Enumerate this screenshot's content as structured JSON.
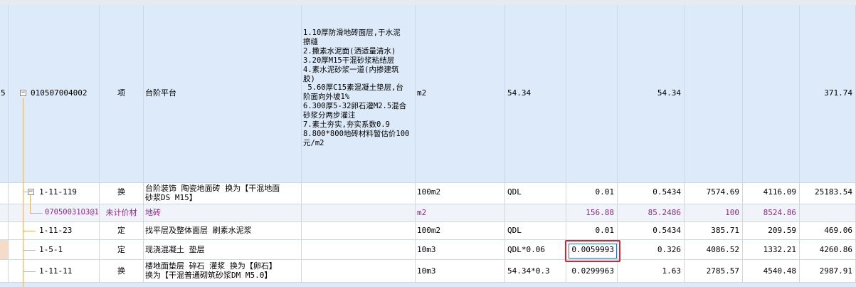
{
  "rows": [
    {
      "row_no": "5",
      "code": "010507004002",
      "category": "项",
      "name": "台阶平台",
      "desc_lines": [
        "1.10厚防滑地砖面层,于水泥",
        "擦缝",
        "2.撒素水泥面(洒适量清水)",
        "3.20厚M15干混砂浆粘结层",
        "4.素水泥砂浆一道(内掺建筑",
        "胶)",
        " 5.60厚C15素混凝土垫层,台",
        "阶面向外坡1%",
        "6.300厚5-32卵石灌M2.5混合",
        "砂浆分两步灌注",
        "7.素土夯实,夯实系数0.9",
        "8.800*800地砖材料暂估价100",
        "元/m2"
      ],
      "unit": "m2",
      "qty_expr": "54.34",
      "content": "",
      "quantity": "54.34",
      "c1": "",
      "c2": "",
      "total": "371.74"
    },
    {
      "code": "1-11-119",
      "category": "换",
      "name_line1": "台阶装饰 陶瓷地面砖   换为【干混地面",
      "name_line2": "砂浆DS M15】",
      "unit": "100m2",
      "qty_expr": "QDL",
      "content": "0.01",
      "quantity": "0.5434",
      "c1": "7574.69",
      "c2": "4116.09",
      "total": "25183.54"
    },
    {
      "code": "07050031O3@1",
      "category": "未计价材",
      "name": "地砖",
      "unit": "m2",
      "qty_expr": "",
      "content": "156.88",
      "quantity": "85.2486",
      "c1": "100",
      "c2": "8524.86",
      "total": ""
    },
    {
      "code": "1-11-23",
      "category": "定",
      "name": "找平层及整体面层 刷素水泥浆",
      "unit": "100m2",
      "qty_expr": "QDL",
      "content": "0.01",
      "quantity": "0.5434",
      "c1": "385.71",
      "c2": "209.59",
      "total": "469.06"
    },
    {
      "code": "1-5-1",
      "category": "定",
      "name": "现浇混凝土 垫层",
      "unit": "10m3",
      "qty_expr": "QDL*0.06",
      "content": "0.0059993",
      "quantity": "0.326",
      "c1": "4086.52",
      "c2": "1332.21",
      "total": "4260.86"
    },
    {
      "code": "1-11-11",
      "category": "换",
      "name_line1": "楼地面垫层 碎石 灌浆  换为【卵石】",
      "name_line2": "换为【干混普通砌筑砂浆DM M5.0】",
      "unit": "10m3",
      "qty_expr": "54.34*0.3",
      "content": "0.0299963",
      "quantity": "1.63",
      "c1": "2785.57",
      "c2": "4540.48",
      "total": "2987.91"
    }
  ],
  "colors": {
    "selected_row": "#ddeaf9",
    "highlight": "#e0202b",
    "purple_text": "#8b2a8b"
  }
}
